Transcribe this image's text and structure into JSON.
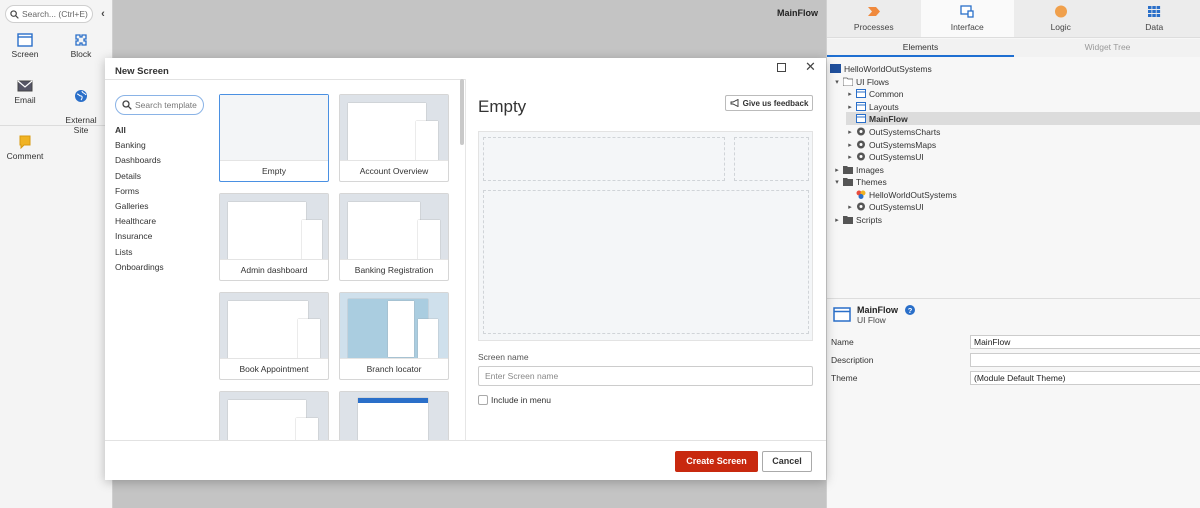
{
  "toolbox": {
    "search_placeholder": "Search... (Ctrl+E)",
    "collapse": "‹",
    "items": [
      {
        "label": "Screen",
        "icon": "screen-icon"
      },
      {
        "label": "Block",
        "icon": "block-icon"
      },
      {
        "label": "Email",
        "icon": "email-icon"
      },
      {
        "label": "External\nSite",
        "icon": "globe-icon"
      },
      {
        "label": "Comment",
        "icon": "comment-icon"
      }
    ]
  },
  "canvas": {
    "title": "MainFlow"
  },
  "right_panel": {
    "tabs": [
      {
        "label": "Processes",
        "icon": "processes-icon",
        "color": "#f0893c"
      },
      {
        "label": "Interface",
        "icon": "interface-icon",
        "color": "#2a6fc9"
      },
      {
        "label": "Logic",
        "icon": "logic-icon",
        "color": "#f0893c"
      },
      {
        "label": "Data",
        "icon": "data-icon",
        "color": "#2a6fc9"
      }
    ],
    "active_tab": "Interface",
    "subtabs": [
      "Elements",
      "Widget Tree"
    ],
    "tree": [
      {
        "label": "HelloWorldOutSystems"
      },
      {
        "label": "UI Flows"
      },
      {
        "label": "Common"
      },
      {
        "label": "Layouts"
      },
      {
        "label": "MainFlow"
      },
      {
        "label": "OutSystemsCharts"
      },
      {
        "label": "OutSystemsMaps"
      },
      {
        "label": "OutSystemsUI"
      },
      {
        "label": "Images"
      },
      {
        "label": "Themes"
      },
      {
        "label": "HelloWorldOutSystems"
      },
      {
        "label": "OutSystemsUI"
      },
      {
        "label": "Scripts"
      }
    ],
    "properties": {
      "title": "MainFlow",
      "subtitle": "UI Flow",
      "rows": [
        {
          "label": "Name",
          "value": "MainFlow"
        },
        {
          "label": "Description",
          "value": ""
        },
        {
          "label": "Theme",
          "value": "(Module Default Theme)"
        }
      ]
    }
  },
  "modal": {
    "title": "New Screen",
    "search_placeholder": "Search template",
    "categories": [
      "All",
      "Banking",
      "Dashboards",
      "Details",
      "Forms",
      "Galleries",
      "Healthcare",
      "Insurance",
      "Lists",
      "Onboardings"
    ],
    "active_category": "All",
    "templates": [
      "Empty",
      "Account Overview",
      "Admin dashboard",
      "Banking Registration",
      "Book Appointment",
      "Branch locator",
      "",
      ""
    ],
    "selected_template": "Empty",
    "preview": {
      "title": "Empty",
      "feedback": "Give us feedback",
      "screen_name_label": "Screen name",
      "screen_name_placeholder": "Enter Screen name",
      "include_in_menu": "Include in menu"
    },
    "create_button": "Create Screen",
    "cancel_button": "Cancel"
  }
}
